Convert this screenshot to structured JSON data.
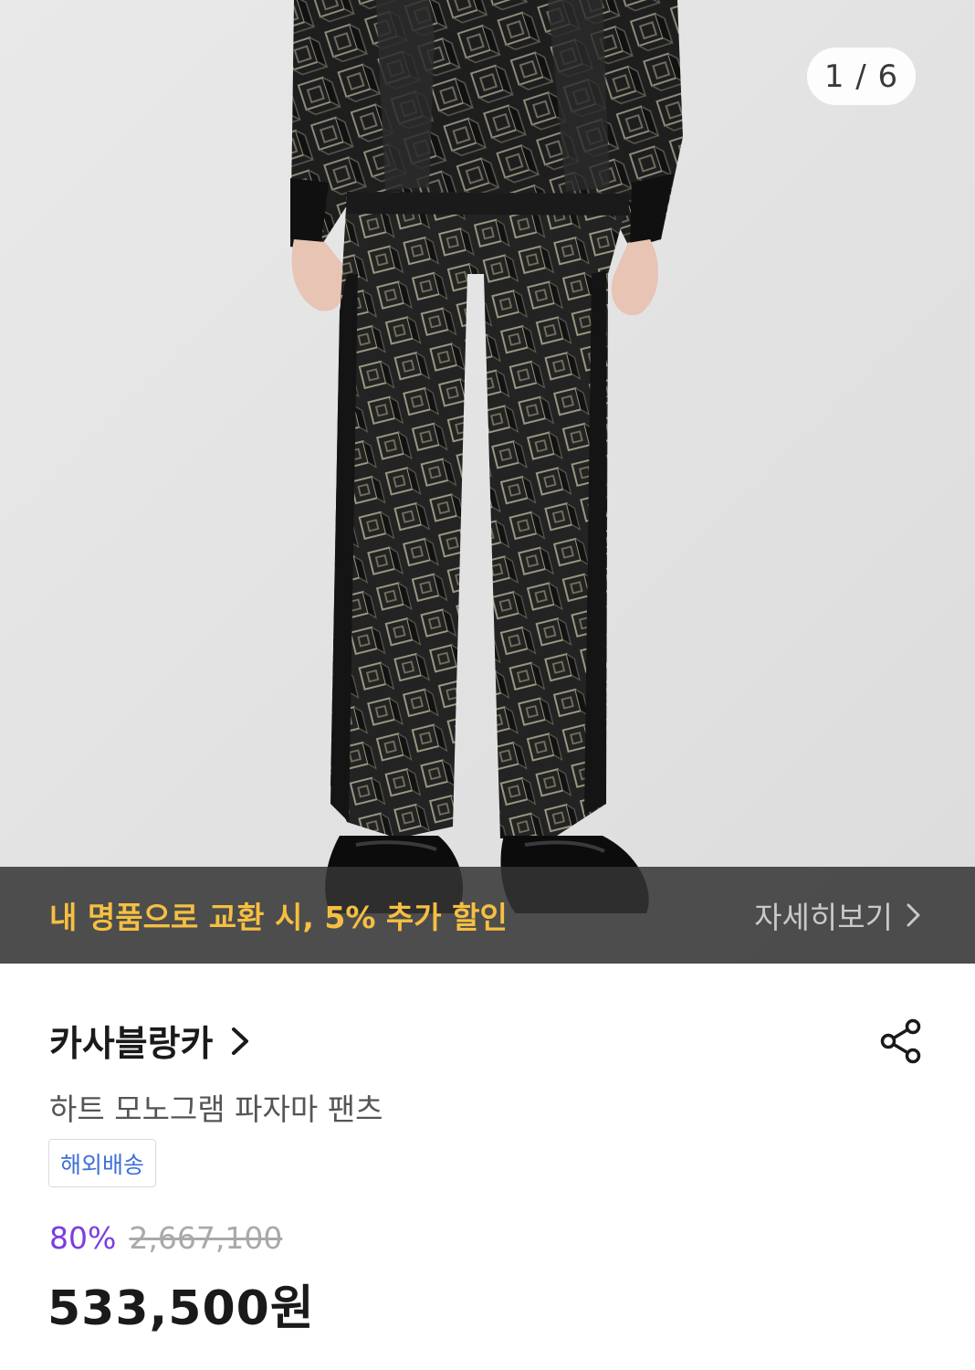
{
  "gallery": {
    "counter": "1 / 6",
    "image_alt": "product-photo"
  },
  "promo": {
    "text": "내 명품으로 교환 시, 5% 추가 할인",
    "link_label": "자세히보기"
  },
  "product": {
    "brand": "카사블랑카",
    "name": "하트 모노그램 파자마 팬츠",
    "badge": "해외배송",
    "discount_rate": "80%",
    "original_price": "2,667,100",
    "final_price": "533,500원"
  },
  "colors": {
    "promo_text": "#f6bf41",
    "discount": "#7b3de0",
    "badge_text": "#3f6fd6"
  },
  "icons": {
    "share": "share-icon",
    "brand_chevron": "chevron-right-icon",
    "promo_chevron": "chevron-right-icon"
  }
}
